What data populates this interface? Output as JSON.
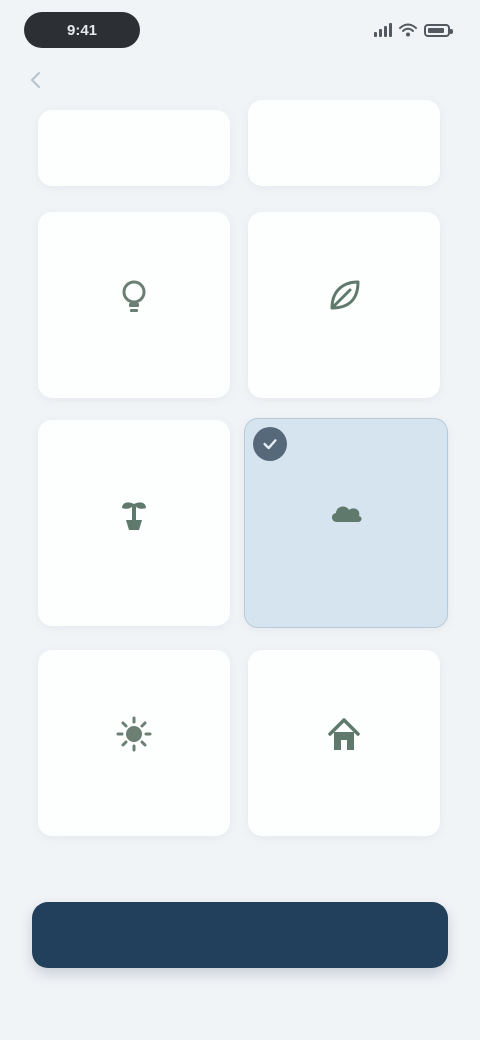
{
  "status_bar": {
    "time": "9:41",
    "icons": [
      "signal-icon",
      "wifi-icon",
      "battery-icon"
    ]
  },
  "nav": {
    "back_icon": "back-arrow-icon"
  },
  "options": [
    {
      "id": "opt-1",
      "label": "",
      "icon": "",
      "selected": false
    },
    {
      "id": "opt-2",
      "label": "",
      "icon": "",
      "selected": false
    },
    {
      "id": "opt-3",
      "label": "",
      "icon": "bulb-icon",
      "selected": false
    },
    {
      "id": "opt-4",
      "label": "",
      "icon": "leaf-icon",
      "selected": false
    },
    {
      "id": "opt-5",
      "label": "",
      "icon": "plant-icon",
      "selected": false
    },
    {
      "id": "opt-6",
      "label": "",
      "icon": "cloud-icon",
      "selected": true
    },
    {
      "id": "opt-7",
      "label": "",
      "icon": "sun-icon",
      "selected": false
    },
    {
      "id": "opt-8",
      "label": "",
      "icon": "house-icon",
      "selected": false
    }
  ],
  "primary_button": {
    "label": ""
  },
  "colors": {
    "background": "#f1f4f7",
    "card": "#fdfefe",
    "selected_card": "#d6e4ef",
    "accent": "#223f5b",
    "icon": "#5f7a6c"
  }
}
